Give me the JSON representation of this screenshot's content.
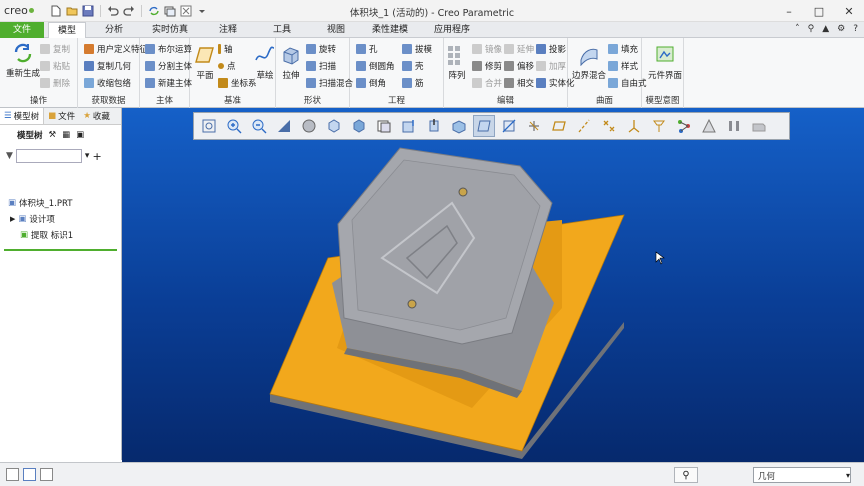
{
  "app": {
    "logo_text": "creo",
    "window_title": "体积块_1 (活动的) - Creo Parametric"
  },
  "tabs": [
    {
      "label": "文件"
    },
    {
      "label": "模型"
    },
    {
      "label": "分析"
    },
    {
      "label": "实时仿真"
    },
    {
      "label": "注释"
    },
    {
      "label": "工具"
    },
    {
      "label": "视图"
    },
    {
      "label": "柔性建模"
    },
    {
      "label": "应用程序"
    }
  ],
  "groups": {
    "operations": {
      "label": "操作",
      "regenerate": "重新生成",
      "copy": "复制",
      "paste": "粘贴",
      "delete": "删除"
    },
    "get_data": {
      "label": "获取数据",
      "udf": "用户定义特征",
      "copy_geometry": "复制几何",
      "shrinkwrap": "收缩包络"
    },
    "body": {
      "label": "主体",
      "boolean": "布尔运算",
      "split_body": "分割主体",
      "new_body": "新建主体"
    },
    "datum": {
      "label": "基准",
      "plane": "平面",
      "axis": "轴",
      "point": "点",
      "csys": "坐标系",
      "sketch": "草绘"
    },
    "shapes": {
      "label": "形状",
      "extrude": "拉伸",
      "revolve": "旋转",
      "sweep": "扫描",
      "swept_blend": "扫描混合"
    },
    "engineering": {
      "label": "工程",
      "hole": "孔",
      "round": "倒圆角",
      "chamfer": "倒角",
      "draft": "拔模",
      "shell": "壳",
      "rib": "筋"
    },
    "editing": {
      "label": "编辑",
      "pattern": "阵列",
      "mirror": "镜像",
      "trim": "修剪",
      "merge": "合并",
      "extend": "延伸",
      "offset": "偏移",
      "intersect": "相交",
      "project": "投影",
      "thicken": "加厚",
      "solidify": "实体化"
    },
    "surfaces": {
      "label": "曲面",
      "boundary_blend": "边界混合",
      "fill": "填充",
      "style": "样式",
      "freestyle": "自由式"
    },
    "model_intent": {
      "label": "模型意图",
      "component_interface": "元件界面"
    }
  },
  "panel": {
    "tab_model_tree": "模型树",
    "tab_folder": "文件",
    "tab_favorites": "收藏",
    "tree_label": "模型树",
    "filter_placeholder": "",
    "tree_items": [
      {
        "label": "体积块_1.PRT"
      },
      {
        "label": "设计项"
      },
      {
        "label": "提取 标识1"
      }
    ]
  },
  "status": {
    "filter_value": "几何"
  },
  "colors": {
    "file_tab": "#4fae2e",
    "viewport_top": "#1560c8",
    "viewport_bottom": "#06296d",
    "plate": "#f2a81c",
    "part": "#8e9096"
  }
}
